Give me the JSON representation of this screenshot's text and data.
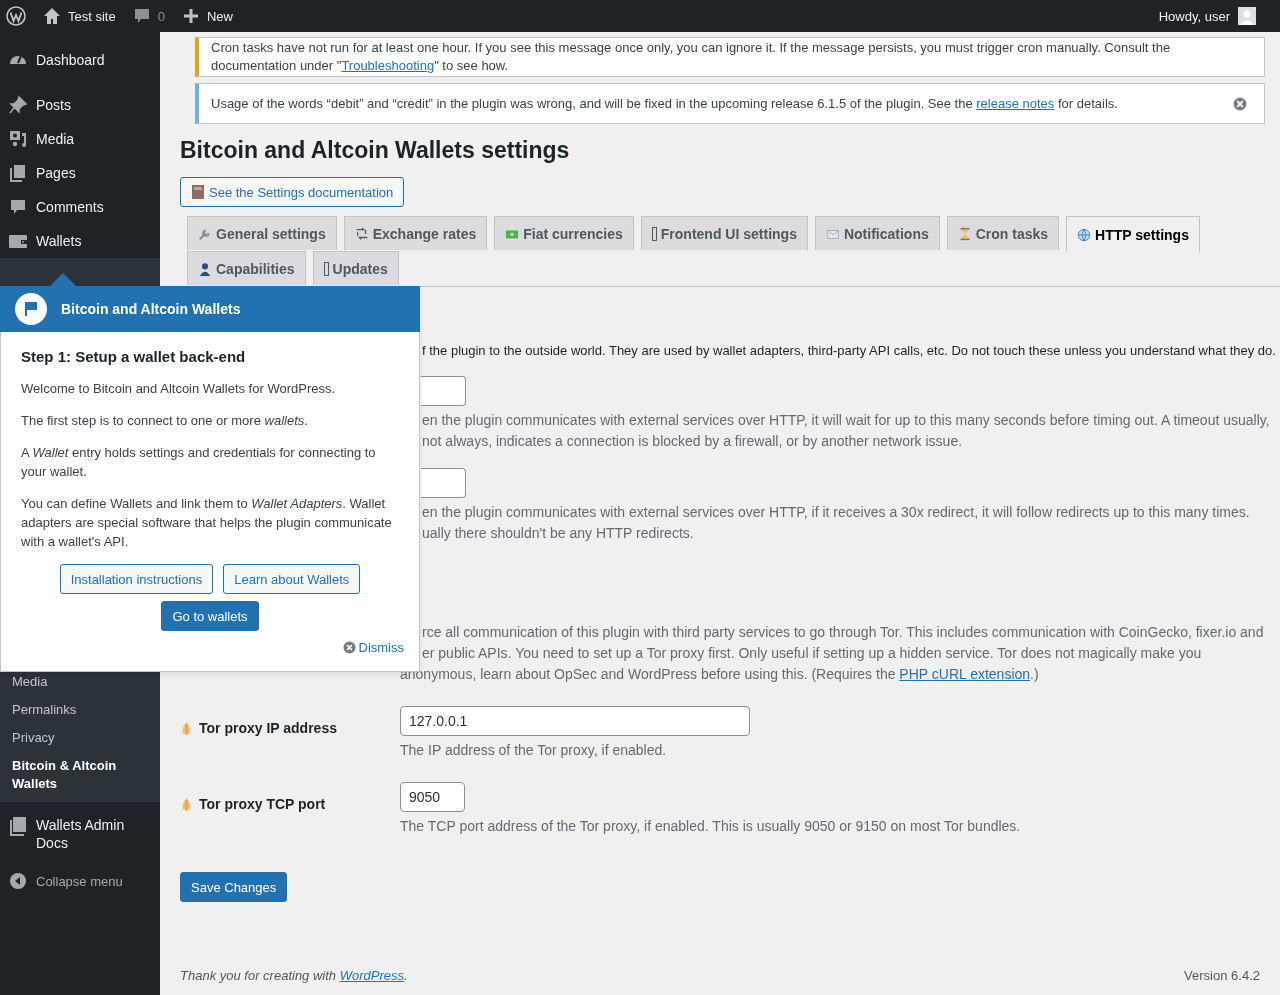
{
  "admin_bar": {
    "site": "Test site",
    "comments_count": "0",
    "new": "New",
    "greeting": "Howdy, user"
  },
  "sidebar": {
    "items": [
      {
        "label": "Dashboard"
      },
      {
        "label": "Posts"
      },
      {
        "label": "Media"
      },
      {
        "label": "Pages"
      },
      {
        "label": "Comments"
      },
      {
        "label": "Wallets"
      }
    ],
    "submenu": [
      {
        "label": "Media",
        "selected": false
      },
      {
        "label": "Permalinks",
        "selected": false
      },
      {
        "label": "Privacy",
        "selected": false
      },
      {
        "label": "Bitcoin & Altcoin Wallets",
        "selected": true
      }
    ],
    "bottom_items": [
      {
        "label": "Wallets Admin Docs"
      }
    ],
    "collapse": "Collapse menu"
  },
  "notices": [
    {
      "kind": "warning",
      "text": "Cron tasks have not run for at least one hour. If you see this message once only, you can ignore it. If the message persists, you must trigger cron manually. Consult the documentation under \"",
      "link": "Troubleshooting",
      "text_after": "\" to see how.",
      "dismissible": false
    },
    {
      "kind": "info",
      "text": "Usage of the words “debit” and “credit” in the plugin was wrong, and will be fixed in the upcoming release 6.1.5 of the plugin. See the ",
      "link": "release notes",
      "text_after": " for details.",
      "dismissible": true
    }
  ],
  "page_title": "Bitcoin and Altcoin Wallets settings",
  "doc_button": "See the Settings documentation",
  "tabs": [
    {
      "label": "General settings",
      "selected": false
    },
    {
      "label": "Exchange rates",
      "selected": false
    },
    {
      "label": "Fiat currencies",
      "selected": false
    },
    {
      "label": "Frontend UI settings",
      "selected": false
    },
    {
      "label": "Notifications",
      "selected": false
    },
    {
      "label": "Cron tasks",
      "selected": false
    },
    {
      "label": "HTTP settings",
      "selected": true
    },
    {
      "label": "Capabilities",
      "selected": false
    },
    {
      "label": "Updates",
      "selected": false
    }
  ],
  "section_intro": "f the plugin to the outside world. They are used by wallet adapters, third-party API calls, etc. Do not touch these unless you understand what they do.",
  "fields": [
    {
      "kind": "covered_input",
      "partial_lines": [
        "en the plugin communicates with external services over HTTP, it will wait for up to this many seconds before timing out. A timeout usually,",
        "not always, indicates a connection is blocked by a firewall, or by another network issue."
      ]
    },
    {
      "kind": "covered_input",
      "partial_lines": [
        "en the plugin communicates with external services over HTTP, if it receives a 30x redirect, it will follow redirects up to this many times.",
        "ually there shouldn't be any HTTP redirects."
      ]
    },
    {
      "kind": "covered_text",
      "partial_lines": [
        "rce all communication of this plugin with third party services to go through Tor. This includes communication with CoinGecko, fixer.io and",
        "er public APIs. You need to set up a Tor proxy first. Only useful if setting up a hidden service. Tor does not magically make you"
      ],
      "lines": [
        {
          "text": "anonymous, learn about OpSec and WordPress before using this. (Requires the ",
          "link": "PHP cURL extension",
          "text_after": ".)"
        }
      ]
    },
    {
      "kind": "wide_input",
      "label": "Tor proxy IP address",
      "value": "127.0.0.1",
      "lines": [
        {
          "text": "The IP address of the Tor proxy, if enabled."
        }
      ]
    },
    {
      "kind": "narrow_input",
      "label": "Tor proxy TCP port",
      "value": "9050",
      "lines": [
        {
          "text": "The TCP port address of the Tor proxy, if enabled. This is usually 9050 or 9150 on most Tor bundles."
        }
      ]
    }
  ],
  "save_button": "Save Changes",
  "footer": {
    "text": "Thank you for creating with ",
    "link": "WordPress",
    "text_after": ".",
    "version": "Version 6.4.2"
  },
  "popup": {
    "title": "Bitcoin and Altcoin Wallets",
    "heading": "Step 1: Setup a wallet back-end",
    "paragraphs": [
      "Welcome to Bitcoin and Altcoin Wallets for WordPress.",
      "The first step is to connect to one or more *wallets*.",
      "A *Wallet* entry holds settings and credentials for connecting to your wallet.",
      "You can define Wallets and link them to *Wallet Adapters*. Wallet adapters are special software that helps the plugin communicate with a wallet's API."
    ],
    "buttons": [
      {
        "label": "Installation instructions",
        "kind": "secondary"
      },
      {
        "label": "Learn about Wallets",
        "kind": "secondary"
      },
      {
        "label": "Go to wallets",
        "kind": "primary"
      }
    ],
    "dismiss": "Dismiss"
  }
}
